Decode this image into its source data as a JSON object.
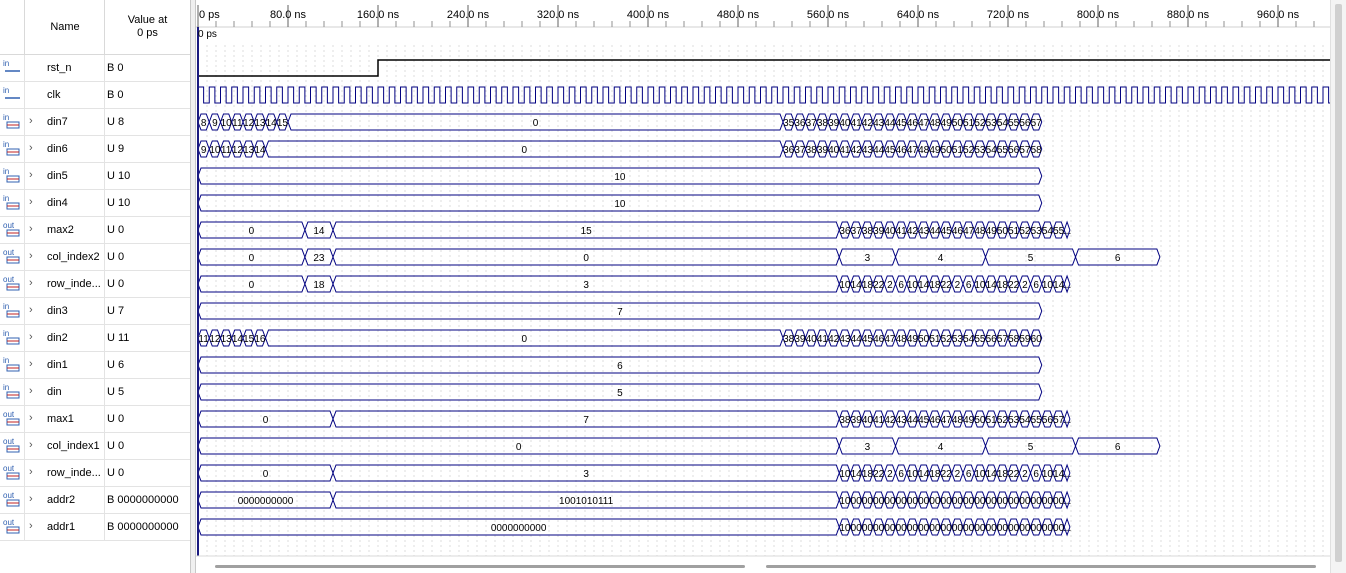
{
  "header": {
    "name_label": "Name",
    "value_label": "Value at\n0 ps"
  },
  "time_axis": {
    "ticks": [
      "0 ps",
      "80.0 ns",
      "160.0 ns",
      "240.0 ns",
      "320.0 ns",
      "400.0 ns",
      "480.0 ns",
      "560.0 ns",
      "640.0 ns",
      "720.0 ns",
      "800.0 ns",
      "880.0 ns",
      "960.0 ns"
    ],
    "cursor_label": "0 ps"
  },
  "signals": [
    {
      "name": "rst_n",
      "value": "B 0",
      "dir": "in",
      "bus": false
    },
    {
      "name": "clk",
      "value": "B 0",
      "dir": "in",
      "bus": false
    },
    {
      "name": "din7",
      "value": "U 8",
      "dir": "in",
      "bus": true
    },
    {
      "name": "din6",
      "value": "U 9",
      "dir": "in",
      "bus": true
    },
    {
      "name": "din5",
      "value": "U 10",
      "dir": "in",
      "bus": true
    },
    {
      "name": "din4",
      "value": "U 10",
      "dir": "in",
      "bus": true
    },
    {
      "name": "max2",
      "value": "U 0",
      "dir": "out",
      "bus": true
    },
    {
      "name": "col_index2",
      "value": "U 0",
      "dir": "out",
      "bus": true
    },
    {
      "name": "row_inde...",
      "value": "U 0",
      "dir": "out",
      "bus": true
    },
    {
      "name": "din3",
      "value": "U 7",
      "dir": "in",
      "bus": true
    },
    {
      "name": "din2",
      "value": "U 11",
      "dir": "in",
      "bus": true
    },
    {
      "name": "din1",
      "value": "U 6",
      "dir": "in",
      "bus": true
    },
    {
      "name": "din",
      "value": "U 5",
      "dir": "in",
      "bus": true
    },
    {
      "name": "max1",
      "value": "U 0",
      "dir": "out",
      "bus": true
    },
    {
      "name": "col_index1",
      "value": "U 0",
      "dir": "out",
      "bus": true
    },
    {
      "name": "row_inde...",
      "value": "U 0",
      "dir": "out",
      "bus": true
    },
    {
      "name": "addr2",
      "value": "B 0000000000",
      "dir": "out",
      "bus": true
    },
    {
      "name": "addr1",
      "value": "B 0000000000",
      "dir": "out",
      "bus": true
    }
  ],
  "waves": [
    {
      "kind": "bit",
      "edges": [
        [
          0,
          0
        ],
        [
          160,
          1
        ]
      ]
    },
    {
      "kind": "clock",
      "period": 10
    },
    {
      "kind": "bus",
      "segs": [
        [
          0,
          10,
          "8"
        ],
        [
          10,
          20,
          "9"
        ],
        [
          20,
          30,
          "10"
        ],
        [
          30,
          40,
          "11"
        ],
        [
          40,
          50,
          "12"
        ],
        [
          50,
          60,
          "13"
        ],
        [
          60,
          70,
          "14"
        ],
        [
          70,
          80,
          "15"
        ],
        [
          80,
          520,
          "0"
        ],
        [
          520,
          530,
          "35"
        ],
        [
          530,
          540,
          "36"
        ],
        [
          540,
          550,
          "37"
        ],
        [
          550,
          560,
          "38"
        ],
        [
          560,
          570,
          "39"
        ],
        [
          570,
          580,
          "40"
        ],
        [
          580,
          590,
          "41"
        ],
        [
          590,
          600,
          "42"
        ],
        [
          600,
          610,
          "43"
        ],
        [
          610,
          620,
          "44"
        ],
        [
          620,
          630,
          "45"
        ],
        [
          630,
          640,
          "46"
        ],
        [
          640,
          650,
          "47"
        ],
        [
          650,
          660,
          "48"
        ],
        [
          660,
          670,
          "49"
        ],
        [
          670,
          680,
          "50"
        ],
        [
          680,
          690,
          "51"
        ],
        [
          690,
          700,
          "52"
        ],
        [
          700,
          710,
          "53"
        ],
        [
          710,
          720,
          "54"
        ],
        [
          720,
          730,
          "55"
        ],
        [
          730,
          740,
          "56"
        ],
        [
          740,
          750,
          "57"
        ]
      ]
    },
    {
      "kind": "bus",
      "segs": [
        [
          0,
          10,
          "9"
        ],
        [
          10,
          20,
          "10"
        ],
        [
          20,
          30,
          "11"
        ],
        [
          30,
          40,
          "12"
        ],
        [
          40,
          50,
          "13"
        ],
        [
          50,
          60,
          "14"
        ],
        [
          60,
          520,
          "0"
        ],
        [
          520,
          530,
          "36"
        ],
        [
          530,
          540,
          "37"
        ],
        [
          540,
          550,
          "38"
        ],
        [
          550,
          560,
          "39"
        ],
        [
          560,
          570,
          "40"
        ],
        [
          570,
          580,
          "41"
        ],
        [
          580,
          590,
          "42"
        ],
        [
          590,
          600,
          "43"
        ],
        [
          600,
          610,
          "44"
        ],
        [
          610,
          620,
          "45"
        ],
        [
          620,
          630,
          "46"
        ],
        [
          630,
          640,
          "47"
        ],
        [
          640,
          650,
          "48"
        ],
        [
          650,
          660,
          "49"
        ],
        [
          660,
          670,
          "50"
        ],
        [
          670,
          680,
          "51"
        ],
        [
          680,
          690,
          "52"
        ],
        [
          690,
          700,
          "53"
        ],
        [
          700,
          710,
          "54"
        ],
        [
          710,
          720,
          "55"
        ],
        [
          720,
          730,
          "56"
        ],
        [
          730,
          740,
          "57"
        ],
        [
          740,
          750,
          "58"
        ]
      ]
    },
    {
      "kind": "bus",
      "segs": [
        [
          0,
          750,
          "10"
        ]
      ]
    },
    {
      "kind": "bus",
      "segs": [
        [
          0,
          750,
          "10"
        ]
      ]
    },
    {
      "kind": "bus",
      "segs": [
        [
          0,
          95,
          "0"
        ],
        [
          95,
          120,
          "14"
        ],
        [
          120,
          570,
          "15"
        ],
        [
          570,
          580,
          "36"
        ],
        [
          580,
          590,
          "37"
        ],
        [
          590,
          600,
          "38"
        ],
        [
          600,
          610,
          "39"
        ],
        [
          610,
          620,
          "40"
        ],
        [
          620,
          630,
          "41"
        ],
        [
          630,
          640,
          "42"
        ],
        [
          640,
          650,
          "43"
        ],
        [
          650,
          660,
          "44"
        ],
        [
          660,
          670,
          "45"
        ],
        [
          670,
          680,
          "46"
        ],
        [
          680,
          690,
          "47"
        ],
        [
          690,
          700,
          "48"
        ],
        [
          700,
          710,
          "49"
        ],
        [
          710,
          720,
          "50"
        ],
        [
          720,
          730,
          "51"
        ],
        [
          730,
          740,
          "52"
        ],
        [
          740,
          750,
          "53"
        ],
        [
          750,
          760,
          "54"
        ],
        [
          760,
          770,
          "55"
        ],
        [
          770,
          775,
          "..."
        ]
      ]
    },
    {
      "kind": "bus",
      "segs": [
        [
          0,
          95,
          "0"
        ],
        [
          95,
          120,
          "23"
        ],
        [
          120,
          570,
          "0"
        ],
        [
          570,
          620,
          "3"
        ],
        [
          620,
          700,
          "4"
        ],
        [
          700,
          780,
          "5"
        ],
        [
          780,
          855,
          "6"
        ]
      ]
    },
    {
      "kind": "bus",
      "segs": [
        [
          0,
          95,
          "0"
        ],
        [
          95,
          120,
          "18"
        ],
        [
          120,
          570,
          "3"
        ],
        [
          570,
          580,
          "10"
        ],
        [
          580,
          590,
          "14"
        ],
        [
          590,
          600,
          "18"
        ],
        [
          600,
          610,
          "22"
        ],
        [
          610,
          620,
          "2"
        ],
        [
          620,
          630,
          "6"
        ],
        [
          630,
          640,
          "10"
        ],
        [
          640,
          650,
          "14"
        ],
        [
          650,
          660,
          "18"
        ],
        [
          660,
          670,
          "22"
        ],
        [
          670,
          680,
          "2"
        ],
        [
          680,
          690,
          "6"
        ],
        [
          690,
          700,
          "10"
        ],
        [
          700,
          710,
          "14"
        ],
        [
          710,
          720,
          "18"
        ],
        [
          720,
          730,
          "22"
        ],
        [
          730,
          740,
          "2"
        ],
        [
          740,
          750,
          "6"
        ],
        [
          750,
          760,
          "10"
        ],
        [
          760,
          770,
          "14"
        ],
        [
          770,
          775,
          "..."
        ]
      ]
    },
    {
      "kind": "bus",
      "segs": [
        [
          0,
          750,
          "7"
        ]
      ]
    },
    {
      "kind": "bus",
      "segs": [
        [
          0,
          10,
          "11"
        ],
        [
          10,
          20,
          "12"
        ],
        [
          20,
          30,
          "13"
        ],
        [
          30,
          40,
          "14"
        ],
        [
          40,
          50,
          "15"
        ],
        [
          50,
          60,
          "16"
        ],
        [
          60,
          520,
          "0"
        ],
        [
          520,
          530,
          "38"
        ],
        [
          530,
          540,
          "39"
        ],
        [
          540,
          550,
          "40"
        ],
        [
          550,
          560,
          "41"
        ],
        [
          560,
          570,
          "42"
        ],
        [
          570,
          580,
          "43"
        ],
        [
          580,
          590,
          "44"
        ],
        [
          590,
          600,
          "45"
        ],
        [
          600,
          610,
          "46"
        ],
        [
          610,
          620,
          "47"
        ],
        [
          620,
          630,
          "48"
        ],
        [
          630,
          640,
          "49"
        ],
        [
          640,
          650,
          "50"
        ],
        [
          650,
          660,
          "51"
        ],
        [
          660,
          670,
          "52"
        ],
        [
          670,
          680,
          "53"
        ],
        [
          680,
          690,
          "54"
        ],
        [
          690,
          700,
          "55"
        ],
        [
          700,
          710,
          "56"
        ],
        [
          710,
          720,
          "57"
        ],
        [
          720,
          730,
          "58"
        ],
        [
          730,
          740,
          "59"
        ],
        [
          740,
          750,
          "60"
        ]
      ]
    },
    {
      "kind": "bus",
      "segs": [
        [
          0,
          750,
          "6"
        ]
      ]
    },
    {
      "kind": "bus",
      "segs": [
        [
          0,
          750,
          "5"
        ]
      ]
    },
    {
      "kind": "bus",
      "segs": [
        [
          0,
          120,
          "0"
        ],
        [
          120,
          570,
          "7"
        ],
        [
          570,
          580,
          "38"
        ],
        [
          580,
          590,
          "39"
        ],
        [
          590,
          600,
          "40"
        ],
        [
          600,
          610,
          "41"
        ],
        [
          610,
          620,
          "42"
        ],
        [
          620,
          630,
          "43"
        ],
        [
          630,
          640,
          "44"
        ],
        [
          640,
          650,
          "45"
        ],
        [
          650,
          660,
          "46"
        ],
        [
          660,
          670,
          "47"
        ],
        [
          670,
          680,
          "48"
        ],
        [
          680,
          690,
          "49"
        ],
        [
          690,
          700,
          "50"
        ],
        [
          700,
          710,
          "51"
        ],
        [
          710,
          720,
          "52"
        ],
        [
          720,
          730,
          "53"
        ],
        [
          730,
          740,
          "54"
        ],
        [
          740,
          750,
          "55"
        ],
        [
          750,
          760,
          "56"
        ],
        [
          760,
          770,
          "57"
        ],
        [
          770,
          775,
          "..."
        ]
      ]
    },
    {
      "kind": "bus",
      "segs": [
        [
          0,
          570,
          "0"
        ],
        [
          570,
          620,
          "3"
        ],
        [
          620,
          700,
          "4"
        ],
        [
          700,
          780,
          "5"
        ],
        [
          780,
          855,
          "6"
        ]
      ]
    },
    {
      "kind": "bus",
      "segs": [
        [
          0,
          120,
          "0"
        ],
        [
          120,
          570,
          "3"
        ],
        [
          570,
          580,
          "10"
        ],
        [
          580,
          590,
          "14"
        ],
        [
          590,
          600,
          "18"
        ],
        [
          600,
          610,
          "22"
        ],
        [
          610,
          620,
          "2"
        ],
        [
          620,
          630,
          "6"
        ],
        [
          630,
          640,
          "10"
        ],
        [
          640,
          650,
          "14"
        ],
        [
          650,
          660,
          "18"
        ],
        [
          660,
          670,
          "22"
        ],
        [
          670,
          680,
          "2"
        ],
        [
          680,
          690,
          "6"
        ],
        [
          690,
          700,
          "10"
        ],
        [
          700,
          710,
          "14"
        ],
        [
          710,
          720,
          "18"
        ],
        [
          720,
          730,
          "22"
        ],
        [
          730,
          740,
          "2"
        ],
        [
          740,
          750,
          "6"
        ],
        [
          750,
          760,
          "10"
        ],
        [
          760,
          770,
          "14"
        ],
        [
          770,
          775,
          "..."
        ]
      ]
    },
    {
      "kind": "bus",
      "segs": [
        [
          0,
          120,
          "0000000000"
        ],
        [
          120,
          570,
          "1001010111"
        ],
        [
          570,
          580,
          "10"
        ],
        [
          580,
          590,
          "00"
        ],
        [
          590,
          600,
          "00"
        ],
        [
          600,
          610,
          "00"
        ],
        [
          610,
          620,
          "00"
        ],
        [
          620,
          630,
          "00"
        ],
        [
          630,
          640,
          "00"
        ],
        [
          640,
          650,
          "00"
        ],
        [
          650,
          660,
          "00"
        ],
        [
          660,
          670,
          "00"
        ],
        [
          670,
          680,
          "00"
        ],
        [
          680,
          690,
          "00"
        ],
        [
          690,
          700,
          "00"
        ],
        [
          700,
          710,
          "00"
        ],
        [
          710,
          720,
          "00"
        ],
        [
          720,
          730,
          "00"
        ],
        [
          730,
          740,
          "00"
        ],
        [
          740,
          750,
          "00"
        ],
        [
          750,
          760,
          "00"
        ],
        [
          760,
          770,
          "00"
        ],
        [
          770,
          775,
          "..."
        ]
      ]
    },
    {
      "kind": "bus",
      "segs": [
        [
          0,
          570,
          "0000000000"
        ],
        [
          570,
          580,
          "10"
        ],
        [
          580,
          590,
          "00"
        ],
        [
          590,
          600,
          "00"
        ],
        [
          600,
          610,
          "00"
        ],
        [
          610,
          620,
          "00"
        ],
        [
          620,
          630,
          "00"
        ],
        [
          630,
          640,
          "00"
        ],
        [
          640,
          650,
          "00"
        ],
        [
          650,
          660,
          "00"
        ],
        [
          660,
          670,
          "00"
        ],
        [
          670,
          680,
          "00"
        ],
        [
          680,
          690,
          "00"
        ],
        [
          690,
          700,
          "00"
        ],
        [
          700,
          710,
          "00"
        ],
        [
          710,
          720,
          "00"
        ],
        [
          720,
          730,
          "00"
        ],
        [
          730,
          740,
          "00"
        ],
        [
          740,
          750,
          "00"
        ],
        [
          750,
          760,
          "00"
        ],
        [
          760,
          770,
          "00"
        ],
        [
          770,
          775,
          "..."
        ]
      ]
    }
  ],
  "colors": {
    "wave": "#000080",
    "bit": "#000000",
    "grid": "#c8c8c8",
    "cursor": "#000080",
    "icon_in": "#3060b0",
    "icon_out": "#3060b0"
  }
}
